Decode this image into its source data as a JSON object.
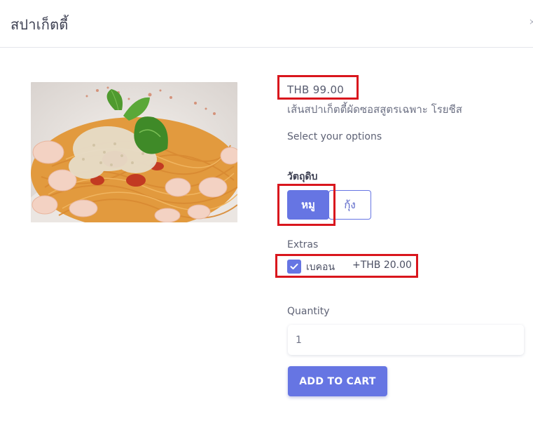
{
  "modal": {
    "title": "สปาเก็ตตี้",
    "close_glyph": "×"
  },
  "product": {
    "image_icon": "pasta-photo",
    "price": "THB 99.00",
    "description": "เส้นสปาเก็ตตี้ผัดซอสสูตรเฉพาะ โรยชีส",
    "select_options_label": "Select your options"
  },
  "options": {
    "group_label": "วัตถุดิบ",
    "choices": [
      {
        "label": "หมู",
        "selected": true
      },
      {
        "label": "กุ้ง",
        "selected": false
      }
    ]
  },
  "extras": {
    "label": "Extras",
    "items": [
      {
        "name": "เบคอน",
        "price": "+THB 20.00",
        "checked": true,
        "icon": "check-icon"
      }
    ]
  },
  "quantity": {
    "label": "Quantity",
    "value": "1"
  },
  "cart": {
    "add_label": "ADD TO CART"
  },
  "colors": {
    "accent": "#6675e3",
    "highlight": "#d9161d"
  }
}
